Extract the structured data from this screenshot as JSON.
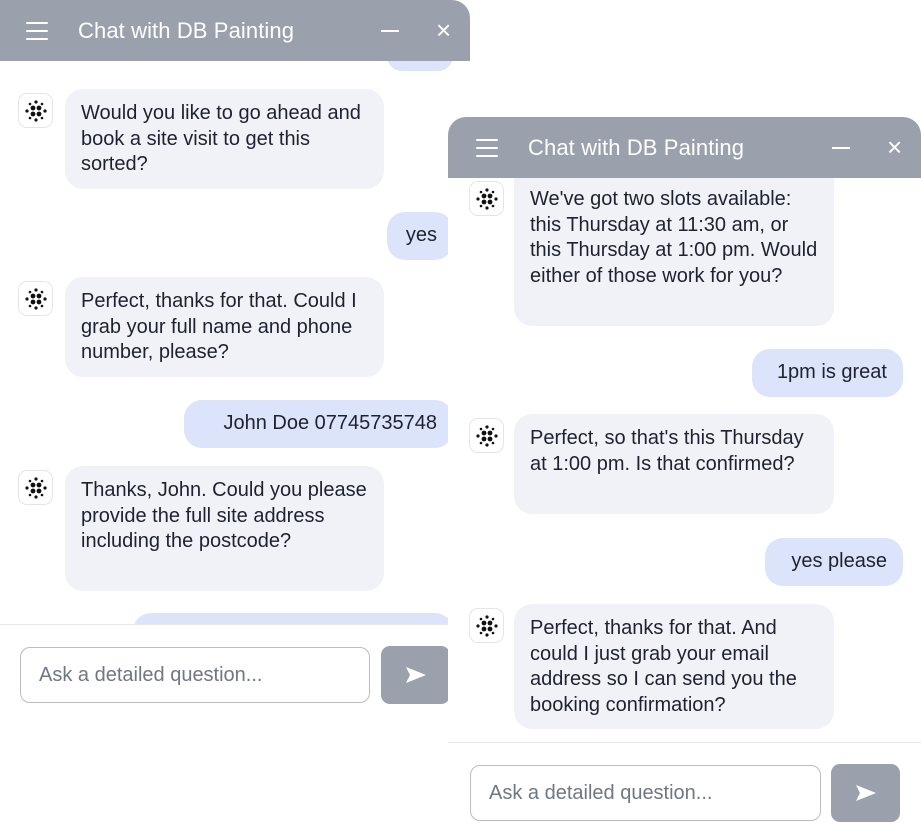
{
  "window1": {
    "title": "Chat with DB Painting",
    "controls": {
      "minimize": "−",
      "close": "×"
    },
    "messages": [
      {
        "role": "bot",
        "text": "Would you like to go ahead and book a site visit to get this sorted?"
      },
      {
        "role": "user",
        "text": "yes"
      },
      {
        "role": "bot",
        "text": "Perfect, thanks for that. Could I grab your full name and phone number, please?"
      },
      {
        "role": "user",
        "text": "John Doe 07745735748"
      },
      {
        "role": "bot",
        "text": "Thanks, John. Could you please provide the full site address including the postcode?"
      }
    ],
    "input_placeholder": "Ask a detailed question..."
  },
  "window2": {
    "title": "Chat with DB Painting",
    "controls": {
      "minimize": "−",
      "close": "×"
    },
    "messages": [
      {
        "role": "bot",
        "text": "We've got two slots available: this Thursday at 11:30 am, or this Thursday at 1:00 pm. Would either of those work for you?"
      },
      {
        "role": "user",
        "text": "1pm is great"
      },
      {
        "role": "bot",
        "text": "Perfect, so that's this Thursday at 1:00 pm. Is that confirmed?"
      },
      {
        "role": "user",
        "text": "yes please"
      },
      {
        "role": "bot",
        "text": "Perfect, thanks for that. And could I just grab your email address so I can send you the booking confirmation?"
      }
    ],
    "input_placeholder": "Ask a detailed question..."
  },
  "icons": {
    "menu": "menu-icon",
    "bot_avatar": "dot-grid-logo-icon",
    "send": "send-arrow-icon"
  },
  "colors": {
    "titlebar": "#9aa1ad",
    "bot_bubble": "#f1f2f7",
    "user_bubble": "#dce4fb",
    "send_button": "#9aa1ad"
  }
}
